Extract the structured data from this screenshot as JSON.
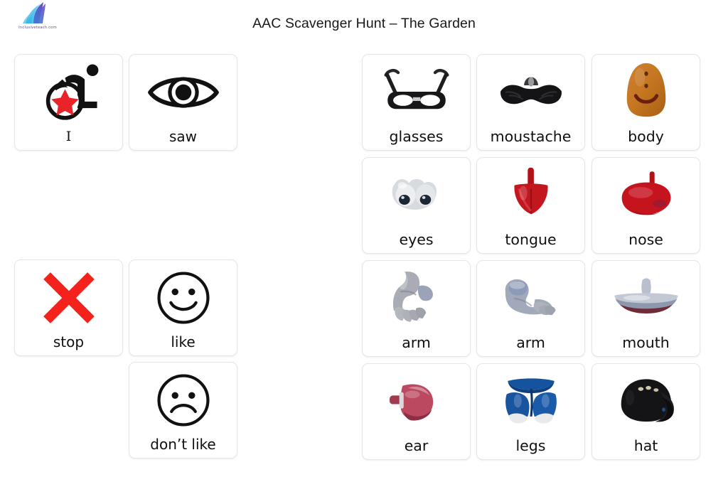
{
  "header": {
    "title": "AAC Scavenger Hunt – The Garden",
    "logo_text": "Inclusiveteach.com",
    "logo_icon": "feather-leaf-icon",
    "accent_color": "#4aa8e0",
    "accent_color_2": "#5b3fa8"
  },
  "symbol_cards": {
    "group_one": [
      {
        "label": "I",
        "icon": "wheelchair-user-star-icon",
        "accent": "#e8232a"
      },
      {
        "label": "saw",
        "icon": "eye-icon",
        "accent": "#000000"
      }
    ],
    "group_two": [
      {
        "label": "stop",
        "icon": "red-cross-x-icon",
        "accent": "#f4221c"
      },
      {
        "label": "like",
        "icon": "smiley-happy-face-icon",
        "accent": "#000000"
      },
      {
        "label": "don’t like",
        "icon": "smiley-sad-face-icon",
        "accent": "#000000"
      }
    ]
  },
  "object_cards": [
    {
      "label": "glasses",
      "icon": "glasses-photo",
      "color": "#1d1d1f"
    },
    {
      "label": "moustache",
      "icon": "moustache-photo",
      "color": "#171717"
    },
    {
      "label": "body",
      "icon": "body-photo",
      "color": "#c77726"
    },
    {
      "label": "eyes",
      "icon": "eyes-photo",
      "color": "#d9dce0"
    },
    {
      "label": "tongue",
      "icon": "tongue-photo",
      "color": "#b4151b"
    },
    {
      "label": "nose",
      "icon": "nose-photo",
      "color": "#c21420"
    },
    {
      "label": "arm",
      "icon": "arm-left-photo",
      "color": "#a7aab2"
    },
    {
      "label": "arm",
      "icon": "arm-right-photo",
      "color": "#9ba3b5"
    },
    {
      "label": "mouth",
      "icon": "mouth-photo",
      "color": "#b9bfcc"
    },
    {
      "label": "ear",
      "icon": "ear-photo",
      "color": "#b8465c"
    },
    {
      "label": "legs",
      "icon": "legs-photo",
      "color": "#17529e"
    },
    {
      "label": "hat",
      "icon": "hat-photo",
      "color": "#121214"
    }
  ]
}
